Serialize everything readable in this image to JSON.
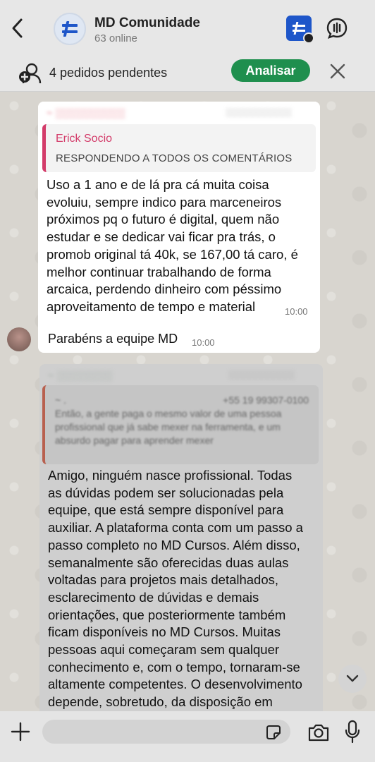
{
  "header": {
    "title": "MD Comunidade",
    "subtitle": "63 online"
  },
  "pending": {
    "text": "4 pedidos pendentes",
    "button": "Analisar"
  },
  "message1": {
    "quote_name": "Erick Socio",
    "quote_text": "RESPONDENDO A TODOS OS COMENTÁRIOS",
    "lines": [
      "Uso a 1 ano e de lá pra cá muita coisa",
      "evoluiu, sempre indico para marceneiros",
      "próximos pq o futuro é digital, quem não",
      "estudar e se dedicar vai ficar pra trás, o",
      "promob original tá 40k, se 167,00 tá caro, é",
      "melhor continuar trabalhando de forma",
      "arcaica, perdendo dinheiro com péssimo",
      "aproveitamento de tempo e material"
    ],
    "time": "10:00"
  },
  "message2": {
    "text": "Parabéns a equipe MD",
    "time": "10:00"
  },
  "message3": {
    "quote_phone": "+55 19 99307-0100",
    "quote_lines": [
      "Então, a gente paga o mesmo valor de uma pessoa",
      "profissional que já sabe mexer na ferramenta, e um",
      "absurdo pagar para aprender mexer"
    ],
    "lines": [
      "Amigo, ninguém nasce profissional. Todas",
      "as dúvidas podem ser solucionadas pela",
      "equipe, que está sempre disponível para",
      "auxiliar. A plataforma conta com um passo a",
      "passo completo no MD Cursos. Além disso,",
      "semanalmente são oferecidas duas aulas",
      "voltadas para projetos mais detalhados,",
      "esclarecimento de dúvidas e demais",
      "orientações, que posteriormente também",
      "ficam disponíveis no MD Cursos. Muitas",
      "pessoas aqui começaram sem qualquer",
      "conhecimento e, com o tempo, tornaram-se",
      "altamente competentes. O desenvolvimento",
      "depende, sobretudo, da disposição em"
    ]
  },
  "colors": {
    "accent_green": "#1f8f4e",
    "quote_pink": "#d33c6a",
    "app_blue": "#1e56c9"
  }
}
